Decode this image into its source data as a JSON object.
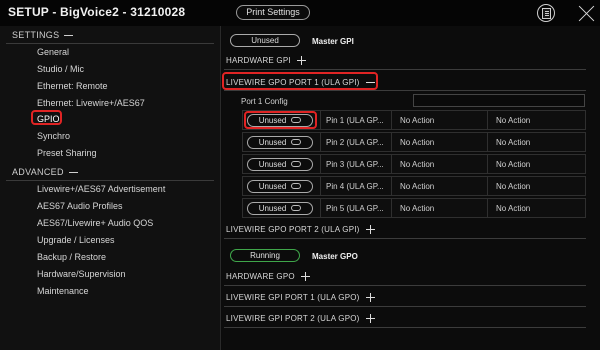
{
  "header": {
    "title": "SETUP - BigVoice2 - 31210028",
    "print_button": "Print Settings",
    "doc_icon": "document-icon",
    "close_icon": "close-icon"
  },
  "sidebar": {
    "settings_header": "SETTINGS",
    "settings_items": [
      {
        "label": "General"
      },
      {
        "label": "Studio / Mic"
      },
      {
        "label": "Ethernet: Remote"
      },
      {
        "label": "Ethernet: Livewire+/AES67"
      },
      {
        "label": "GPIO"
      },
      {
        "label": "Synchro"
      },
      {
        "label": "Preset Sharing"
      }
    ],
    "selected": "GPIO",
    "advanced_header": "ADVANCED",
    "advanced_items": [
      {
        "label": "Livewire+/AES67 Advertisement"
      },
      {
        "label": "AES67 Audio Profiles"
      },
      {
        "label": "AES67/Livewire+ Audio QOS"
      },
      {
        "label": "Upgrade / Licenses"
      },
      {
        "label": "Backup / Restore"
      },
      {
        "label": "Hardware/Supervision"
      },
      {
        "label": "Maintenance"
      }
    ]
  },
  "main": {
    "gpi": {
      "status": "Unused",
      "label": "Master GPI",
      "hardware_label": "HARDWARE GPI"
    },
    "gpo_port1": {
      "title": "LIVEWIRE GPO PORT 1 (ULA GPI)",
      "config_label": "Port 1 Config",
      "config_value": "",
      "pins": [
        {
          "status": "Unused",
          "name": "Pin 1 (ULA GP...",
          "action1": "No Action",
          "action2": "No Action"
        },
        {
          "status": "Unused",
          "name": "Pin 2 (ULA GP...",
          "action1": "No Action",
          "action2": "No Action"
        },
        {
          "status": "Unused",
          "name": "Pin 3 (ULA GP...",
          "action1": "No Action",
          "action2": "No Action"
        },
        {
          "status": "Unused",
          "name": "Pin 4 (ULA GP...",
          "action1": "No Action",
          "action2": "No Action"
        },
        {
          "status": "Unused",
          "name": "Pin 5 (ULA GP...",
          "action1": "No Action",
          "action2": "No Action"
        }
      ]
    },
    "gpo_port2_title": "LIVEWIRE GPO PORT 2 (ULA GPI)",
    "gpo": {
      "status": "Running",
      "label": "Master GPO",
      "hardware_label": "HARDWARE GPO"
    },
    "gpi_port1_title": "LIVEWIRE GPI PORT 1 (ULA GPO)",
    "gpi_port2_title": "LIVEWIRE GPI PORT 2 (ULA GPO)"
  },
  "colors": {
    "highlight": "#e02424",
    "running": "#3fa64a",
    "background": "#0b0b0b"
  }
}
